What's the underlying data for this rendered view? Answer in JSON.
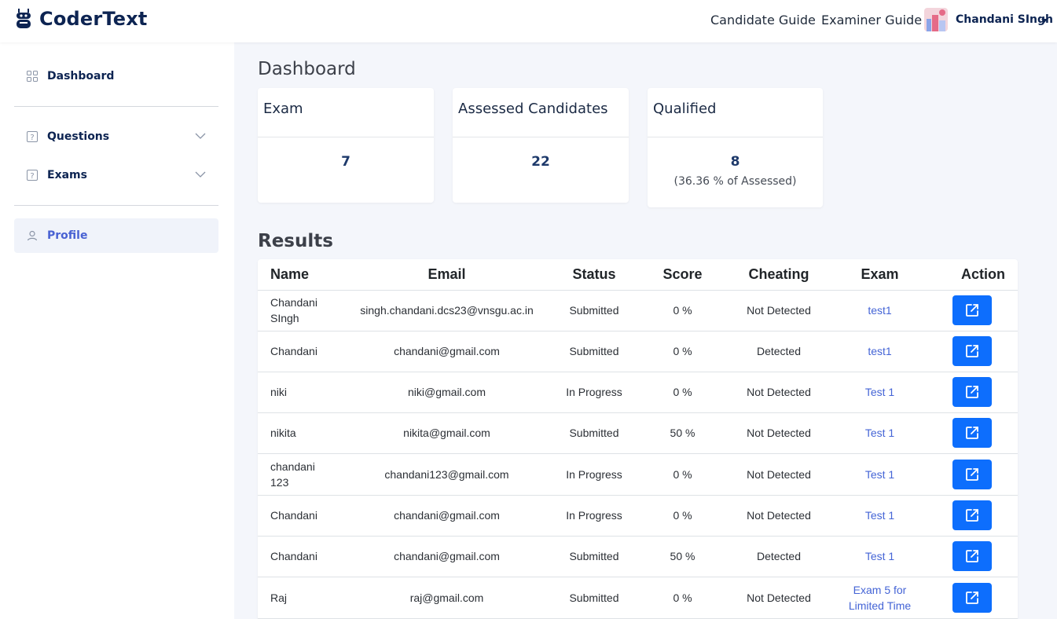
{
  "app": {
    "name": "CoderText",
    "logo_icon": "coder-robot-icon"
  },
  "header": {
    "nav": [
      "Candidate Guide",
      "Examiner Guide"
    ],
    "user_name": "Chandani SIngh"
  },
  "sidebar": {
    "items": [
      {
        "label": "Dashboard",
        "icon": "grid-icon"
      },
      {
        "label": "Questions",
        "icon": "question-box-icon"
      },
      {
        "label": "Exams",
        "icon": "question-box-icon"
      },
      {
        "label": "Profile",
        "icon": "user-icon"
      }
    ]
  },
  "page": {
    "title": "Dashboard",
    "results_title": "Results"
  },
  "cards": [
    {
      "title": "Exam",
      "value": "7",
      "sub": ""
    },
    {
      "title": "Assessed Candidates",
      "value": "22",
      "sub": ""
    },
    {
      "title": "Qualified",
      "value": "8",
      "sub": "(36.36 % of Assessed)"
    }
  ],
  "table": {
    "headers": [
      "Name",
      "Email",
      "Status",
      "Score",
      "Cheating",
      "Exam",
      "Action"
    ],
    "rows": [
      {
        "name": "Chandani SIngh",
        "email": "singh.chandani.dcs23@vnsgu.ac.in",
        "status": "Submitted",
        "score": "0 %",
        "cheating": "Not Detected",
        "exam": "test1"
      },
      {
        "name": "Chandani",
        "email": "chandani@gmail.com",
        "status": "Submitted",
        "score": "0 %",
        "cheating": "Detected",
        "exam": "test1"
      },
      {
        "name": "niki",
        "email": "niki@gmail.com",
        "status": "In Progress",
        "score": "0 %",
        "cheating": "Not Detected",
        "exam": "Test 1"
      },
      {
        "name": "nikita",
        "email": "nikita@gmail.com",
        "status": "Submitted",
        "score": "50 %",
        "cheating": "Not Detected",
        "exam": "Test 1"
      },
      {
        "name": "chandani 123",
        "email": "chandani123@gmail.com",
        "status": "In Progress",
        "score": "0 %",
        "cheating": "Not Detected",
        "exam": "Test 1"
      },
      {
        "name": "Chandani",
        "email": "chandani@gmail.com",
        "status": "In Progress",
        "score": "0 %",
        "cheating": "Not Detected",
        "exam": "Test 1"
      },
      {
        "name": "Chandani",
        "email": "chandani@gmail.com",
        "status": "Submitted",
        "score": "50 %",
        "cheating": "Detected",
        "exam": "Test 1"
      },
      {
        "name": "Raj",
        "email": "raj@gmail.com",
        "status": "Submitted",
        "score": "0 %",
        "cheating": "Not Detected",
        "exam": "Exam 5 for Limited Time"
      }
    ]
  },
  "colors": {
    "brand": "#0d2452",
    "primary": "#0d6efd",
    "link": "#4464d6",
    "background": "#f4f6fb"
  }
}
